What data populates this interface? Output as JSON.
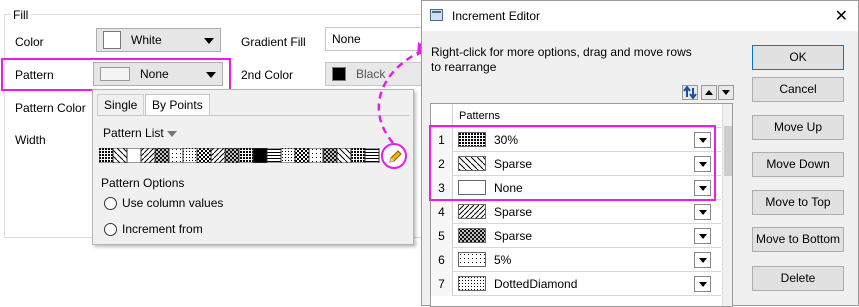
{
  "fill_panel": {
    "group_title": "Fill",
    "color_label": "Color",
    "color_value": "White",
    "gradient_label": "Gradient Fill",
    "gradient_value": "None",
    "pattern_label": "Pattern",
    "pattern_value": "None",
    "second_color_label": "2nd Color",
    "second_color_value": "Black",
    "pattern_color_label": "Pattern Color",
    "width_label": "Width"
  },
  "pattern_popup": {
    "tabs": [
      "Single",
      "By Points"
    ],
    "active_tab": "By Points",
    "pattern_list_label": "Pattern List",
    "options_label": "Pattern Options",
    "radio_column": "Use column values",
    "radio_increment": "Increment from"
  },
  "dialog": {
    "title": "Increment Editor",
    "close_glyph": "✕",
    "hint": "Right-click for more options, drag and move rows to  rearrange",
    "column_header": "Patterns",
    "buttons": {
      "ok": "OK",
      "cancel": "Cancel",
      "move_up": "Move Up",
      "move_down": "Move Down",
      "move_top": "Move to Top",
      "move_bottom": "Move to Bottom",
      "delete": "Delete"
    },
    "rows": [
      {
        "num": "1",
        "name": "30%",
        "pattern": "dense"
      },
      {
        "num": "2",
        "name": "Sparse",
        "pattern": "backslash"
      },
      {
        "num": "3",
        "name": "None",
        "pattern": "none"
      },
      {
        "num": "4",
        "name": "Sparse",
        "pattern": "slash"
      },
      {
        "num": "5",
        "name": "Sparse",
        "pattern": "cross"
      },
      {
        "num": "6",
        "name": "5%",
        "pattern": "dots"
      },
      {
        "num": "7",
        "name": "DottedDiamond",
        "pattern": "diamond"
      }
    ]
  },
  "colors": {
    "highlight": "#e61ee6",
    "dialog_bg": "#f0f0f0",
    "default_button_border": "#0078d7"
  }
}
